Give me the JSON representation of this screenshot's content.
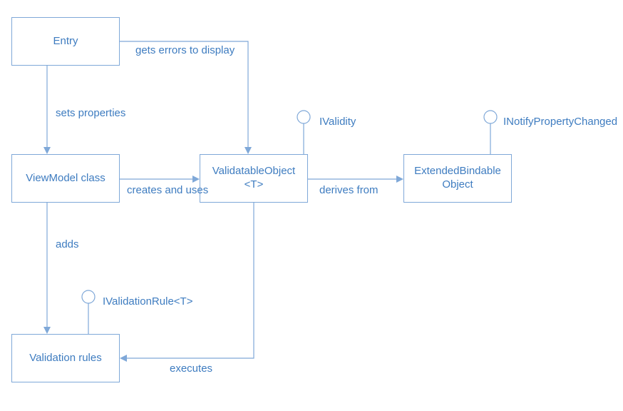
{
  "boxes": {
    "entry": "Entry",
    "viewmodel": "ViewModel class",
    "validatable": "ValidatableObject\n<T>",
    "extbindable": "ExtendedBindable\nObject",
    "validationrules": "Validation rules"
  },
  "edges": {
    "gets_errors": "gets errors to display",
    "sets_properties": "sets properties",
    "creates_uses": "creates and uses",
    "derives_from": "derives from",
    "adds": "adds",
    "executes": "executes"
  },
  "interfaces": {
    "ivalidity": "IValidity",
    "inpc": "INotifyPropertyChanged",
    "ivalidationrule": "IValidationRule<T>"
  }
}
